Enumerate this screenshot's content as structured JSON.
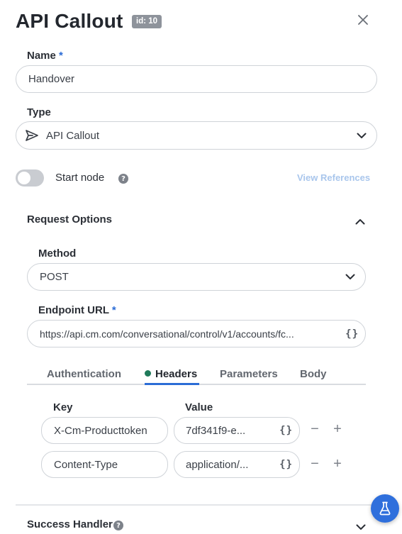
{
  "header": {
    "title": "API Callout",
    "id_badge": "id: 10"
  },
  "name": {
    "label": "Name",
    "required_mark": "*",
    "value": "Handover"
  },
  "type": {
    "label": "Type",
    "value": "API Callout"
  },
  "start_node": {
    "label": "Start node",
    "enabled": false,
    "help": "?"
  },
  "view_references": "View References",
  "request_options": {
    "title": "Request Options",
    "method": {
      "label": "Method",
      "value": "POST"
    },
    "endpoint": {
      "label": "Endpoint URL",
      "required_mark": "*",
      "value": "https://api.cm.com/conversational/control/v1/accounts/fc...",
      "braces": "{}"
    },
    "tabs": [
      {
        "label": "Authentication"
      },
      {
        "label": "Headers"
      },
      {
        "label": "Parameters"
      },
      {
        "label": "Body"
      }
    ],
    "active_tab": "Headers",
    "headers": {
      "key_label": "Key",
      "value_label": "Value",
      "rows": [
        {
          "key": "X-Cm-Producttoken",
          "value": "7df341f9-e...",
          "braces": "{}",
          "minus": "−",
          "plus": "+"
        },
        {
          "key": "Content-Type",
          "value": "application/...",
          "braces": "{}",
          "minus": "−",
          "plus": "+"
        }
      ]
    }
  },
  "success_handler": {
    "title": "Success Handler",
    "help": "?"
  },
  "colors": {
    "accent": "#2b6cd6",
    "fab": "#2f6fdc",
    "active_dot": "#1f7a5a",
    "muted_link": "#a9c6ec"
  }
}
